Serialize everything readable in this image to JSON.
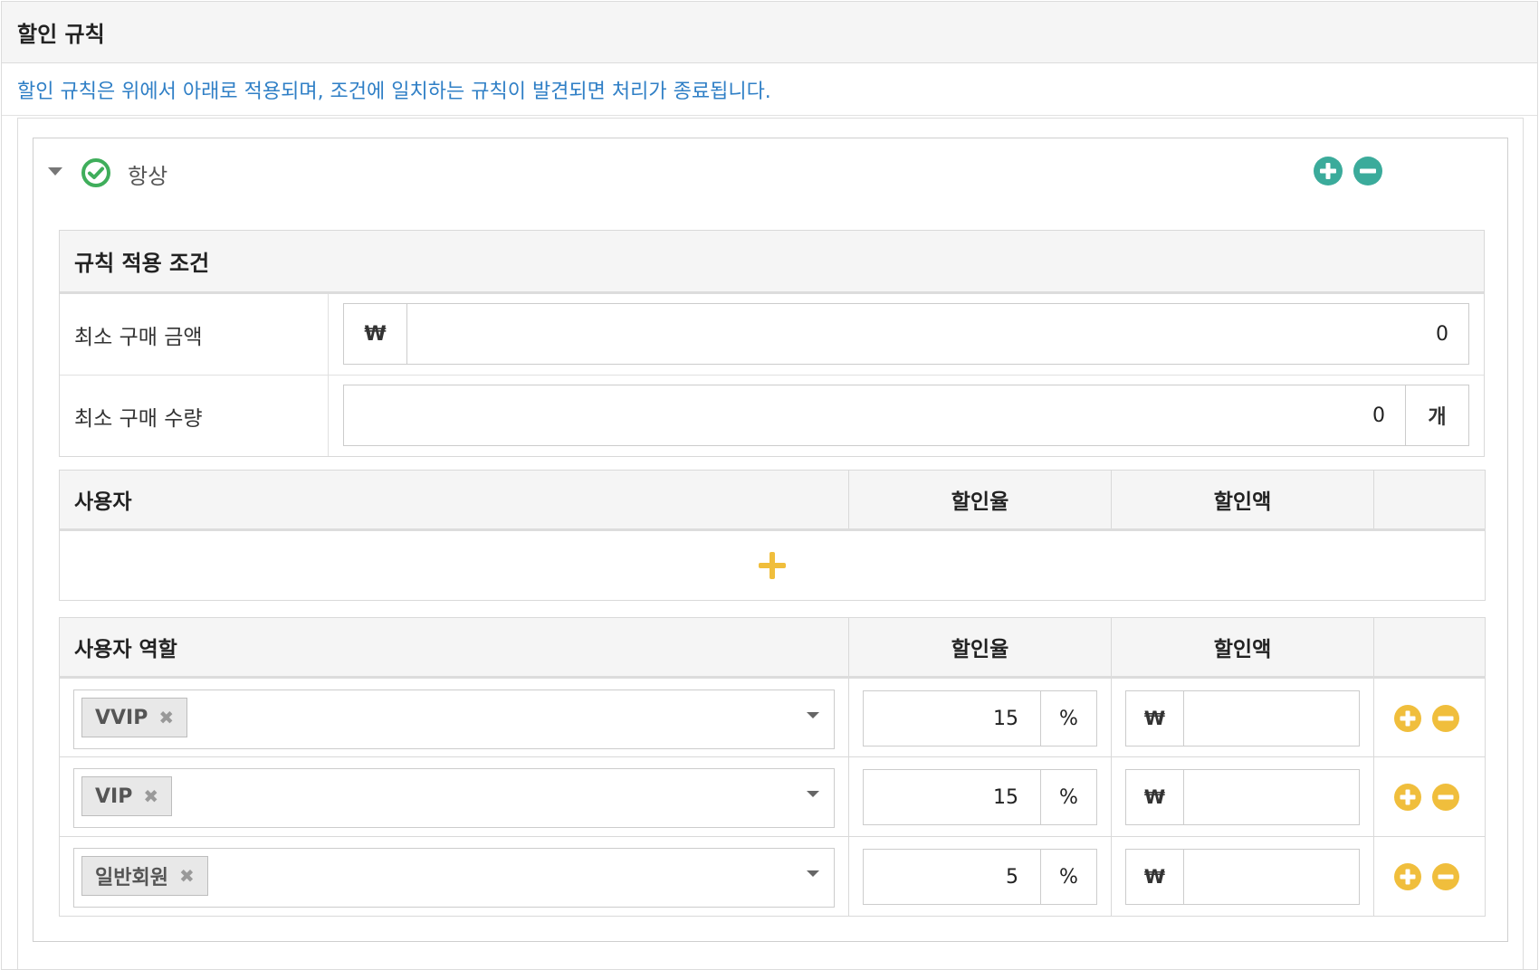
{
  "panel": {
    "title": "할인 규칙",
    "notice": "할인 규칙은 위에서 아래로 적용되며, 조건에 일치하는 규칙이 발견되면 처리가 종료됩니다."
  },
  "rule": {
    "name": "항상",
    "colors": {
      "teal": "#3bab9b",
      "green_check": "#3fae5b",
      "yellow": "#f0be3c",
      "notice_blue": "#2f7fc6"
    },
    "conditions": {
      "header": "규칙 적용 조건",
      "min_amount": {
        "label": "최소 구매 금액",
        "prefix": "₩",
        "value": "0"
      },
      "min_qty": {
        "label": "최소 구매 수량",
        "value": "0",
        "suffix": "개"
      }
    },
    "users": {
      "headers": {
        "user": "사용자",
        "rate": "할인율",
        "amount": "할인액"
      }
    },
    "roles": {
      "headers": {
        "role": "사용자 역할",
        "rate": "할인율",
        "amount": "할인액"
      },
      "rows": [
        {
          "role": "VVIP",
          "rate": "15",
          "rate_unit": "%",
          "amount_unit": "₩",
          "amount": ""
        },
        {
          "role": "VIP",
          "rate": "15",
          "rate_unit": "%",
          "amount_unit": "₩",
          "amount": ""
        },
        {
          "role": "일반회원",
          "rate": "5",
          "rate_unit": "%",
          "amount_unit": "₩",
          "amount": ""
        }
      ]
    }
  },
  "icons": {
    "collapse": "caret-down-icon",
    "status": "check-circle-icon",
    "add": "plus-circle-icon",
    "remove": "minus-circle-icon",
    "add_row": "plus-icon",
    "tag_remove": "times-icon",
    "select": "chevron-down-icon"
  }
}
